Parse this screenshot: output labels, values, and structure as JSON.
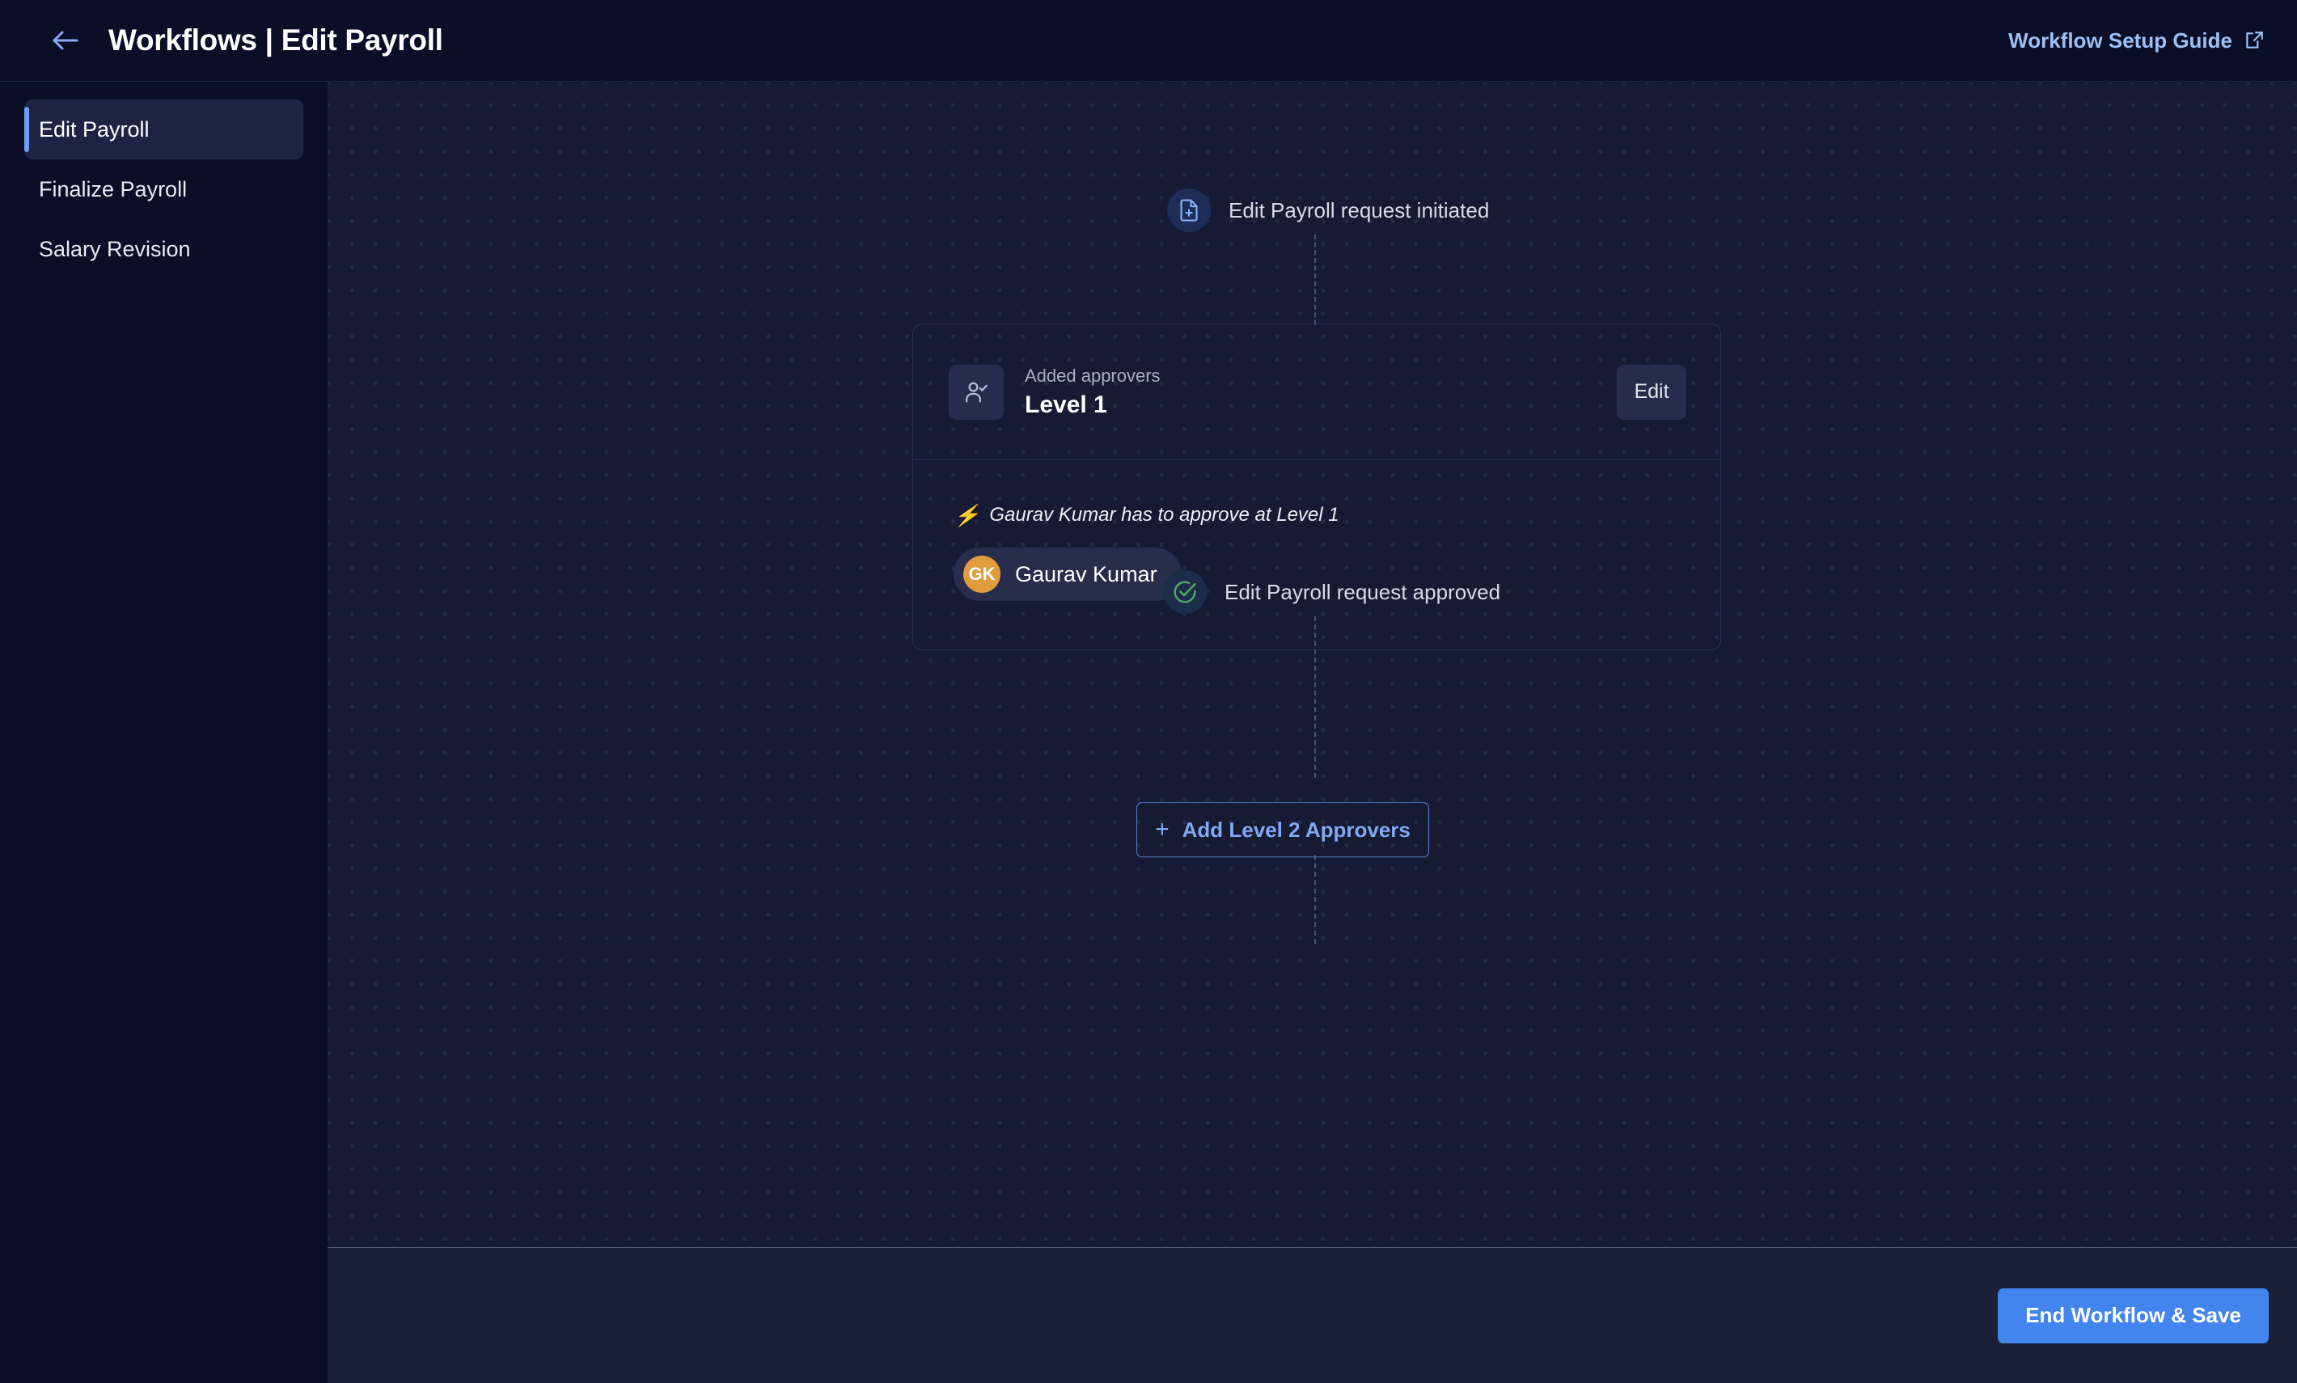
{
  "header": {
    "back_icon": "arrow-left-icon",
    "title": "Workflows | Edit Payroll",
    "guide_link": "Workflow Setup Guide",
    "guide_icon": "external-link-icon"
  },
  "sidebar": {
    "items": [
      {
        "label": "Edit Payroll",
        "active": true
      },
      {
        "label": "Finalize Payroll",
        "active": false
      },
      {
        "label": "Salary Revision",
        "active": false
      }
    ]
  },
  "canvas": {
    "nodes": {
      "start": {
        "label": "Edit Payroll request initiated",
        "icon": "file-plus-icon"
      },
      "end": {
        "label": "Edit Payroll request approved",
        "icon": "check-circle-icon"
      }
    },
    "approver_card": {
      "icon": "user-check-icon",
      "kicker": "Added approvers",
      "title": "Level 1",
      "edit_label": "Edit",
      "rule_icon": "lightning-bolt-icon",
      "rule_text": "Gaurav Kumar has to approve at Level 1",
      "approvers": [
        {
          "initials": "GK",
          "name": "Gaurav Kumar",
          "avatar_color": "#e09c3e"
        }
      ]
    },
    "add_level_button": {
      "plus": "+",
      "label": "Add Level 2 Approvers"
    }
  },
  "footer": {
    "primary_button": "End Workflow & Save"
  },
  "colors": {
    "accent_blue": "#4285ee",
    "link_blue": "#9dc0f5",
    "canvas_bg": "#161a33",
    "sidebar_bg": "#0a0e26",
    "footer_bg": "#1b2039",
    "success_green": "#4aad63",
    "avatar_orange": "#e09c3e"
  }
}
